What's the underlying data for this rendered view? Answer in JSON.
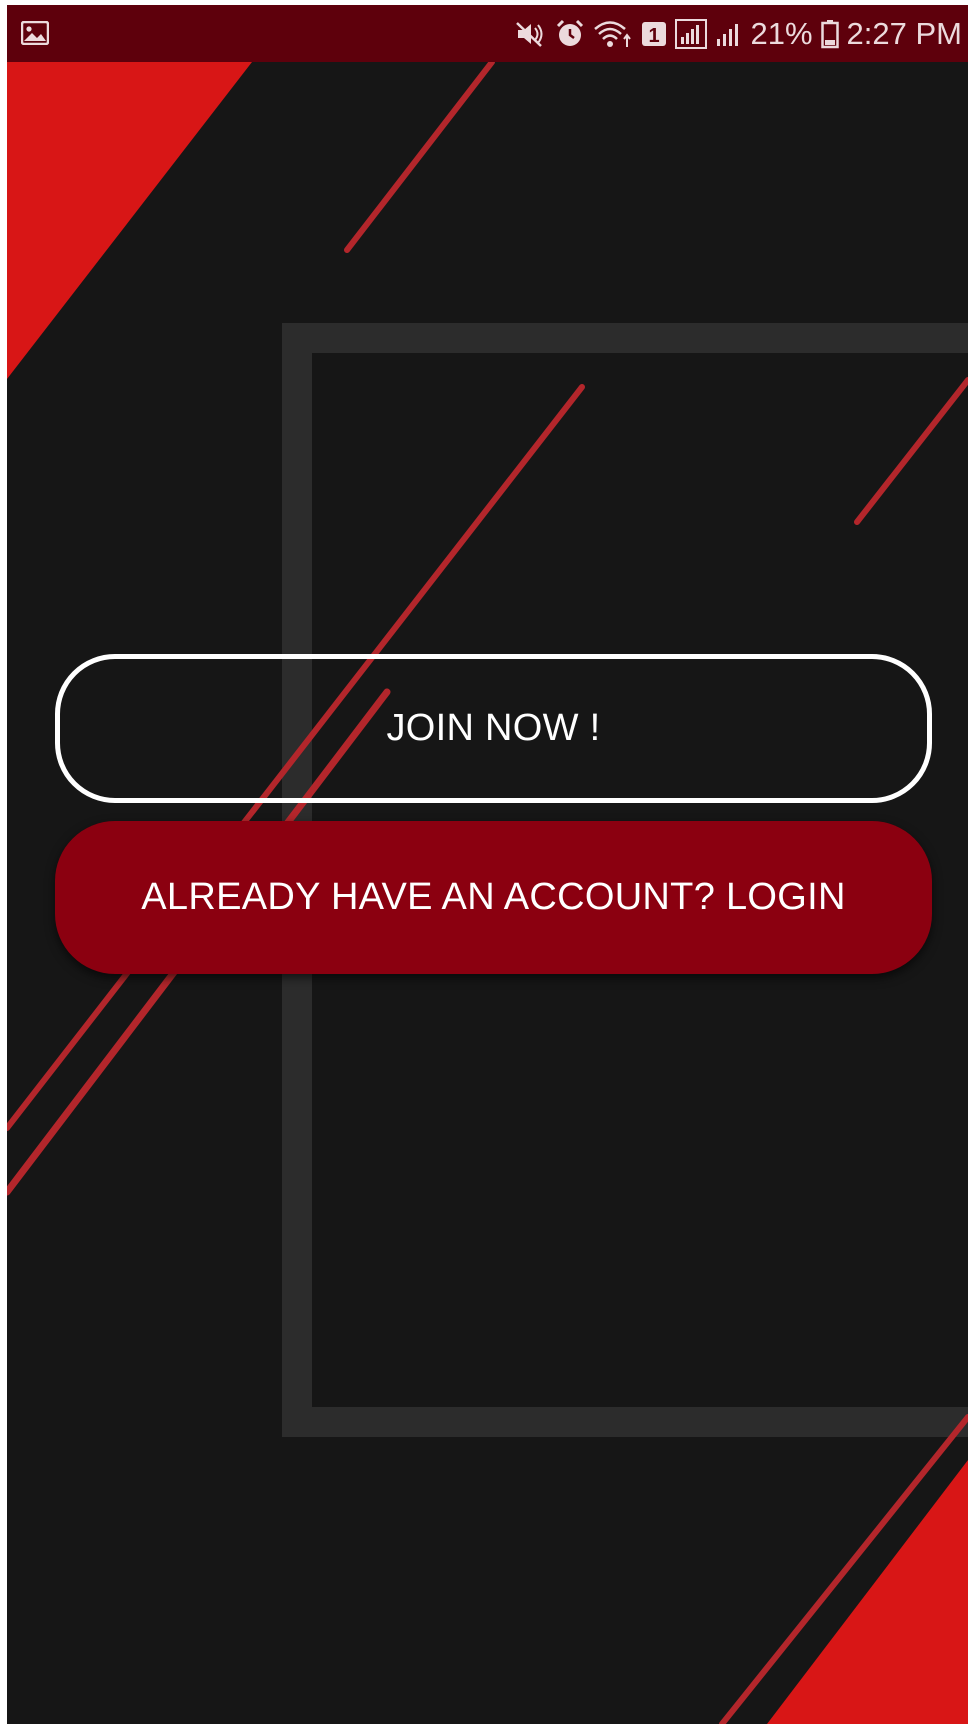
{
  "status_bar": {
    "battery_percent": "21%",
    "time": "2:27 PM",
    "icons": [
      "image-notification-icon",
      "mute-icon",
      "alarm-icon",
      "wifi-icon",
      "sim-1-icon",
      "signal-icon",
      "signal-2-icon",
      "battery-icon"
    ]
  },
  "buttons": {
    "join_label": "JOIN NOW !",
    "login_label": "ALREADY HAVE AN ACCOUNT? LOGIN"
  },
  "colors": {
    "status_bar": "#5e000c",
    "background": "#161616",
    "accent_red": "#d81616",
    "login_button": "#8b0010",
    "stripe": "#b3262b",
    "frame": "#2c2c2c"
  }
}
